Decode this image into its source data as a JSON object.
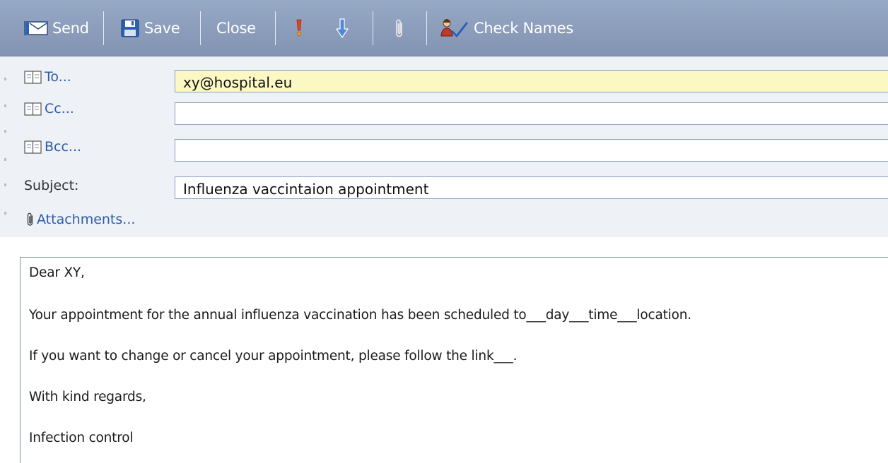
{
  "toolbar": {
    "send_label": "Send",
    "save_label": "Save",
    "close_label": "Close",
    "check_names_label": "Check Names",
    "icons": {
      "send": "envelope-icon",
      "save": "floppy-disk-icon",
      "importance_high": "exclamation-icon",
      "importance_low": "down-arrow-icon",
      "attach": "paperclip-icon",
      "check_names": "person-check-icon"
    }
  },
  "header": {
    "to_label": "To...",
    "to_value": "xy@hospital.eu",
    "cc_label": "Cc...",
    "cc_value": "",
    "bcc_label": "Bcc...",
    "bcc_value": "",
    "subject_label": "Subject:",
    "subject_value": "Influenza vaccintaion appointment",
    "attachments_label": "Attachments..."
  },
  "message": {
    "greeting": "Dear XY,",
    "line1": "Your appointment for the annual influenza vaccination has been scheduled to___day___time___location.",
    "line2": "If you want to change or cancel your appointment, please follow the link___.",
    "closing": "With kind regards,",
    "signature": "Infection control"
  },
  "colors": {
    "toolbar_bg": "#8b9dba",
    "header_bg": "#eef1f5",
    "to_field_bg": "#fbf8c4",
    "link_text": "#2f5ca8"
  }
}
